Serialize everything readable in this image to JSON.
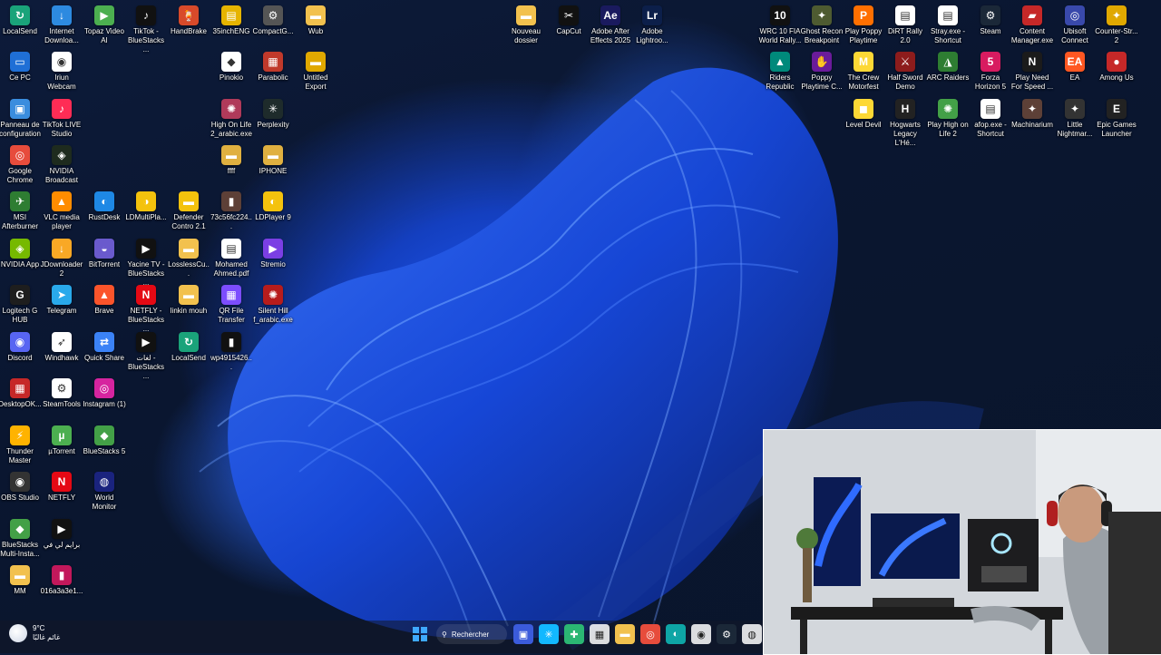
{
  "desktop_icons": [
    {
      "label": "LocalSend",
      "color": "#1aa37a",
      "sym": "↻"
    },
    {
      "label": "Internet Downloa...",
      "color": "#2d8ae0",
      "sym": "↓"
    },
    {
      "label": "Topaz Video AI",
      "color": "#4caf50",
      "sym": "▶"
    },
    {
      "label": "TikTok - BlueStacks ...",
      "color": "#111111",
      "sym": "♪"
    },
    {
      "label": "HandBrake",
      "color": "#d84a2a",
      "sym": "🍹"
    },
    {
      "label": "35inchENG",
      "color": "#e6b400",
      "sym": "▤"
    },
    {
      "label": "CompactG...",
      "color": "#555555",
      "sym": "⚙"
    },
    {
      "label": "Wub",
      "color": "#f2c14e",
      "sym": "▬"
    },
    {
      "label": "Ce PC",
      "color": "#1f6fd6",
      "sym": "▭"
    },
    {
      "label": "Iriun Webcam",
      "color": "#ffffff",
      "sym": "◉"
    },
    {
      "label": "Pinokio",
      "color": "#ffffff",
      "sym": "◆"
    },
    {
      "label": "Parabolic",
      "color": "#c0392b",
      "sym": "▦"
    },
    {
      "label": "Untitled Export",
      "color": "#e0a800",
      "sym": "▬"
    },
    {
      "label": "Panneau de configuration",
      "color": "#3a8dde",
      "sym": "▣"
    },
    {
      "label": "TikTok LIVE Studio",
      "color": "#ff2c55",
      "sym": "♪"
    },
    {
      "label": "High On Life 2_arabic.exe",
      "color": "#b03a5a",
      "sym": "✺"
    },
    {
      "label": "Perplexity",
      "color": "#1e2b2b",
      "sym": "✳"
    },
    {
      "label": "Google Chrome",
      "color": "#e74c3c",
      "sym": "◎"
    },
    {
      "label": "NVIDIA Broadcast",
      "color": "#1e2b1e",
      "sym": "◈"
    },
    {
      "label": "ffff",
      "color": "#e0b040",
      "sym": "▬"
    },
    {
      "label": "IPHONE",
      "color": "#e0b040",
      "sym": "▬"
    },
    {
      "label": "MSI Afterburner",
      "color": "#2e7d32",
      "sym": "✈"
    },
    {
      "label": "VLC media player",
      "color": "#ff8c00",
      "sym": "▲"
    },
    {
      "label": "RustDesk",
      "color": "#1e88e5",
      "sym": "◐"
    },
    {
      "label": "LDMultiPla...",
      "color": "#f4c20d",
      "sym": "◑"
    },
    {
      "label": "Defender Contro 2.1",
      "color": "#f4c20d",
      "sym": "▬"
    },
    {
      "label": "73c56fc224...",
      "color": "#5d4037",
      "sym": "▮"
    },
    {
      "label": "LDPlayer 9",
      "color": "#f4c20d",
      "sym": "◐"
    },
    {
      "label": "NVIDIA App",
      "color": "#76b900",
      "sym": "◈"
    },
    {
      "label": "JDownloader 2",
      "color": "#f9a825",
      "sym": "↓"
    },
    {
      "label": "BitTorrent",
      "color": "#6a5acd",
      "sym": "◒"
    },
    {
      "label": "Yacine TV - BlueStacks ...",
      "color": "#111111",
      "sym": "▶"
    },
    {
      "label": "LosslessCu...",
      "color": "#f2c14e",
      "sym": "▬"
    },
    {
      "label": "Mohamed Ahmed.pdf",
      "color": "#ffffff",
      "sym": "▤"
    },
    {
      "label": "Stremio",
      "color": "#7b3fe4",
      "sym": "▶"
    },
    {
      "label": "Logitech G HUB",
      "color": "#1e1e1e",
      "sym": "G"
    },
    {
      "label": "Telegram",
      "color": "#29a9eb",
      "sym": "➤"
    },
    {
      "label": "Brave",
      "color": "#fb542b",
      "sym": "▲"
    },
    {
      "label": "NETFLY - BlueStacks ...",
      "color": "#e50914",
      "sym": "N"
    },
    {
      "label": "linkin mouh",
      "color": "#f2c14e",
      "sym": "▬"
    },
    {
      "label": "QR File Transfer",
      "color": "#7c4dff",
      "sym": "▦"
    },
    {
      "label": "Silent Hill f_arabic.exe",
      "color": "#b71c1c",
      "sym": "✺"
    },
    {
      "label": "Discord",
      "color": "#5865f2",
      "sym": "◉"
    },
    {
      "label": "Windhawk",
      "color": "#ffffff",
      "sym": "➶"
    },
    {
      "label": "Quick Share",
      "color": "#3b82f6",
      "sym": "⇄"
    },
    {
      "label": "لغات - BlueStacks ...",
      "color": "#111111",
      "sym": "▶"
    },
    {
      "label": "LocalSend",
      "color": "#1aa37a",
      "sym": "↻"
    },
    {
      "label": "wp4915426...",
      "color": "#111111",
      "sym": "▮"
    },
    {
      "label": "DesktopOK...",
      "color": "#c62828",
      "sym": "▦"
    },
    {
      "label": "SteamTools",
      "color": "#ffffff",
      "sym": "⚙"
    },
    {
      "label": "Instagram (1)",
      "color": "#d6249f",
      "sym": "◎"
    },
    {
      "label": "Thunder Master",
      "color": "#ffb300",
      "sym": "⚡"
    },
    {
      "label": "µTorrent",
      "color": "#4caf50",
      "sym": "µ"
    },
    {
      "label": "BlueStacks 5",
      "color": "#43a047",
      "sym": "◆"
    },
    {
      "label": "OBS Studio",
      "color": "#333333",
      "sym": "◉"
    },
    {
      "label": "NETFLY",
      "color": "#e50914",
      "sym": "N"
    },
    {
      "label": "World Monitor",
      "color": "#1a237e",
      "sym": "◍"
    },
    {
      "label": "BlueStacks Multi-Insta...",
      "color": "#43a047",
      "sym": "◆"
    },
    {
      "label": "برايم لي في",
      "color": "#111111",
      "sym": "▶"
    },
    {
      "label": "MM",
      "color": "#f2c14e",
      "sym": "▬"
    },
    {
      "label": "016a3a3e1...",
      "color": "#c2185b",
      "sym": "▮"
    },
    {
      "label": "Nouveau dossier",
      "color": "#f2c14e",
      "sym": "▬"
    },
    {
      "label": "CapCut",
      "color": "#111111",
      "sym": "✂"
    },
    {
      "label": "Adobe After Effects 2025",
      "color": "#1a1a5e",
      "sym": "Ae"
    },
    {
      "label": "Adobe Lightroo...",
      "color": "#0c1f4a",
      "sym": "Lr"
    },
    {
      "label": "WRC 10 FIA World Rally...",
      "color": "#111111",
      "sym": "10"
    },
    {
      "label": "Ghost Recon Breakpoint",
      "color": "#4e5b31",
      "sym": "✦"
    },
    {
      "label": "Play Poppy Playtime",
      "color": "#ff6f00",
      "sym": "P"
    },
    {
      "label": "DiRT Rally 2.0",
      "color": "#ffffff",
      "sym": "▤"
    },
    {
      "label": "Stray.exe - Shortcut",
      "color": "#ffffff",
      "sym": "▤"
    },
    {
      "label": "Steam",
      "color": "#1b2838",
      "sym": "⚙"
    },
    {
      "label": "Content Manager.exe",
      "color": "#c62828",
      "sym": "▰"
    },
    {
      "label": "Ubisoft Connect",
      "color": "#3949ab",
      "sym": "◎"
    },
    {
      "label": "Counter-Str... 2",
      "color": "#e0a800",
      "sym": "✦"
    },
    {
      "label": "Riders Republic",
      "color": "#00897b",
      "sym": "▲"
    },
    {
      "label": "Poppy Playtime C...",
      "color": "#6a1b9a",
      "sym": "✋"
    },
    {
      "label": "The Crew Motorfest",
      "color": "#fdd835",
      "sym": "M"
    },
    {
      "label": "Half Sword Demo",
      "color": "#8d1c1c",
      "sym": "⚔"
    },
    {
      "label": "ARC Raiders",
      "color": "#2e7d32",
      "sym": "◮"
    },
    {
      "label": "Forza Horizon 5",
      "color": "#d81b60",
      "sym": "5"
    },
    {
      "label": "Play Need For Speed ...",
      "color": "#1b1b1b",
      "sym": "N"
    },
    {
      "label": "EA",
      "color": "#ff5722",
      "sym": "EA"
    },
    {
      "label": "Among Us",
      "color": "#c62828",
      "sym": "●"
    },
    {
      "label": "Level Devil",
      "color": "#fdd835",
      "sym": "◼"
    },
    {
      "label": "Hogwarts Legacy L'Hé...",
      "color": "#222222",
      "sym": "H"
    },
    {
      "label": "Play High on Life 2",
      "color": "#43a047",
      "sym": "✺"
    },
    {
      "label": "afop.exe - Shortcut",
      "color": "#ffffff",
      "sym": "▤"
    },
    {
      "label": "Machinarium",
      "color": "#5d4037",
      "sym": "✦"
    },
    {
      "label": "Little Nightmar...",
      "color": "#333333",
      "sym": "✦"
    },
    {
      "label": "Epic Games Launcher",
      "color": "#222222",
      "sym": "E"
    }
  ],
  "taskbar": {
    "weather_temp": "9°C",
    "weather_desc": "غائم غالبًا",
    "search_label": "Rechercher",
    "pinned": [
      {
        "name": "widgets",
        "color": "#3b5bdb",
        "sym": "▣"
      },
      {
        "name": "copilot",
        "color": "#12b8ff",
        "sym": "✳"
      },
      {
        "name": "spotify-like",
        "color": "#2bb673",
        "sym": "✚"
      },
      {
        "name": "store",
        "color": "#ffffff",
        "sym": "▦"
      },
      {
        "name": "file-explorer",
        "color": "#f2c14e",
        "sym": "▬"
      },
      {
        "name": "chrome",
        "color": "#e74c3c",
        "sym": "◎"
      },
      {
        "name": "edge",
        "color": "#0ea5a5",
        "sym": "◐"
      },
      {
        "name": "obs",
        "color": "#ffffff",
        "sym": "◉"
      },
      {
        "name": "steam",
        "color": "#1b2838",
        "sym": "⚙"
      },
      {
        "name": "recorder",
        "color": "#ffffff",
        "sym": "◍"
      }
    ]
  }
}
